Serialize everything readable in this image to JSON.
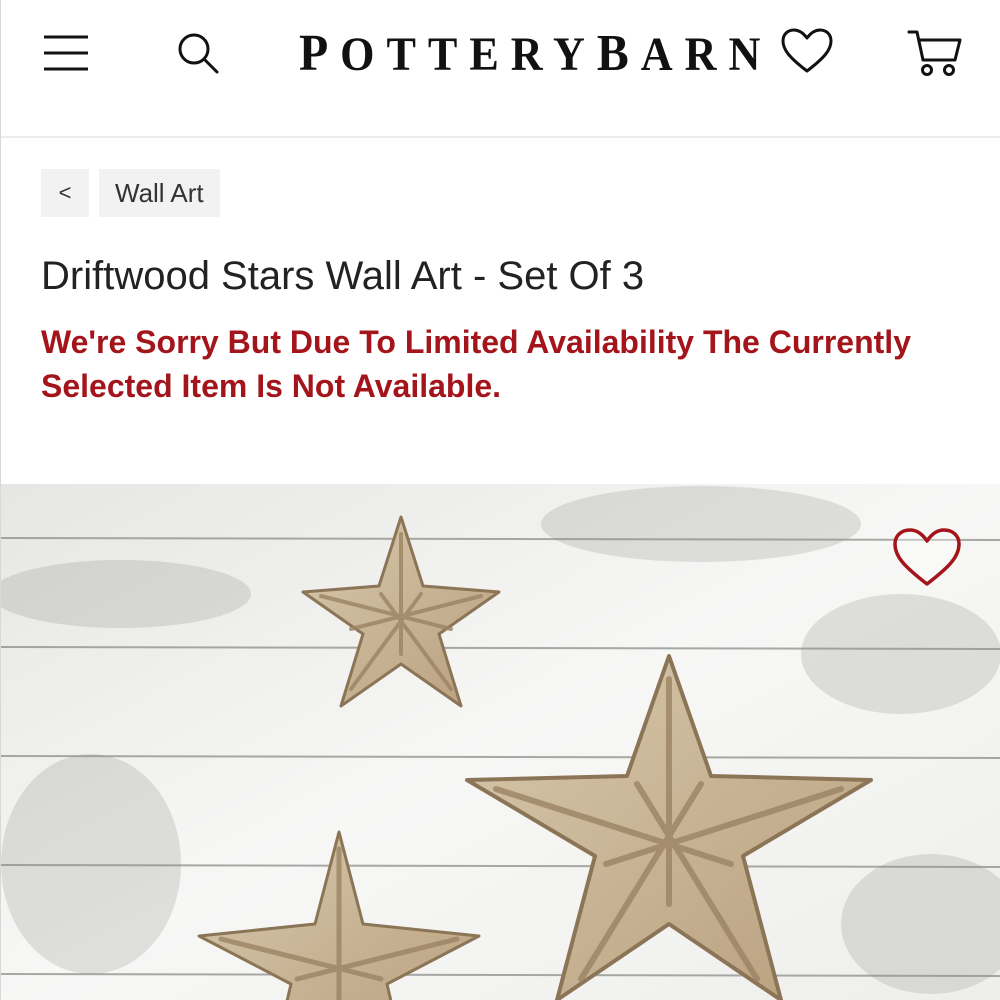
{
  "header": {
    "logo": {
      "part1_initial": "P",
      "part1_rest": "OTTERY",
      "part2_initial": "B",
      "part2_rest": "ARN"
    },
    "icons": {
      "menu": "hamburger-menu-icon",
      "search": "search-icon",
      "wishlist": "heart-icon",
      "cart": "cart-icon"
    }
  },
  "breadcrumb": {
    "back_label": "<",
    "category_label": "Wall Art"
  },
  "product": {
    "title": "Driftwood Stars Wall Art - Set Of 3",
    "availability_notice": "We're Sorry But Due To Limited Availability The Currently Selected Item Is Not Available.",
    "image_favorite_icon": "heart-outline-icon"
  },
  "colors": {
    "notice_red": "#a3151b",
    "favorite_red": "#a3151b",
    "text_dark": "#222222",
    "breadcrumb_bg": "#f2f2f2",
    "driftwood": "#c9b597"
  }
}
